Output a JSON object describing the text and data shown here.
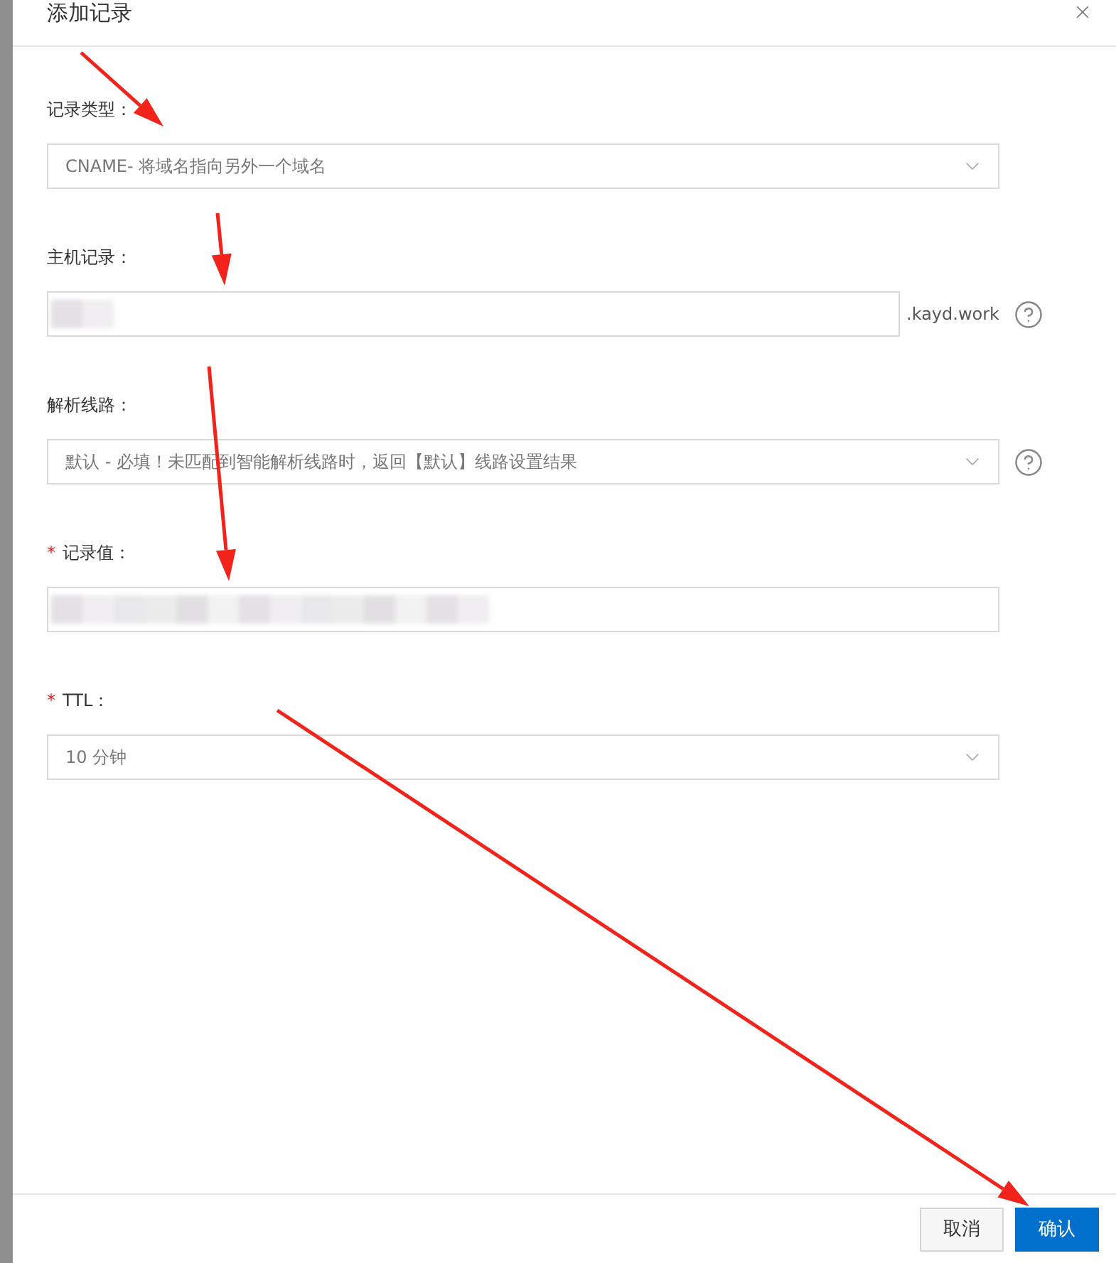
{
  "dialog": {
    "title": "添加记录"
  },
  "fields": [
    {
      "kind": "select",
      "label": "记录类型：",
      "value": "CNAME- 将域名指向另外一个域名",
      "help": false
    },
    {
      "kind": "input",
      "label": "主机记录：",
      "value_blurred": true,
      "suffix": ".kayd.work",
      "help": true
    },
    {
      "kind": "select",
      "label": "解析线路：",
      "value": "默认 - 必填！未匹配到智能解析线路时，返回【默认】线路设置结果",
      "help": true
    },
    {
      "kind": "input",
      "label": "记录值：",
      "required_mark": "*",
      "value_blurred": true,
      "help": false
    },
    {
      "kind": "select",
      "label": "TTL：",
      "required_mark": "*",
      "value": "10 分钟",
      "help": false
    }
  ],
  "buttons": [
    {
      "label": "取消",
      "primary": false
    },
    {
      "label": "确认",
      "primary": true
    }
  ]
}
